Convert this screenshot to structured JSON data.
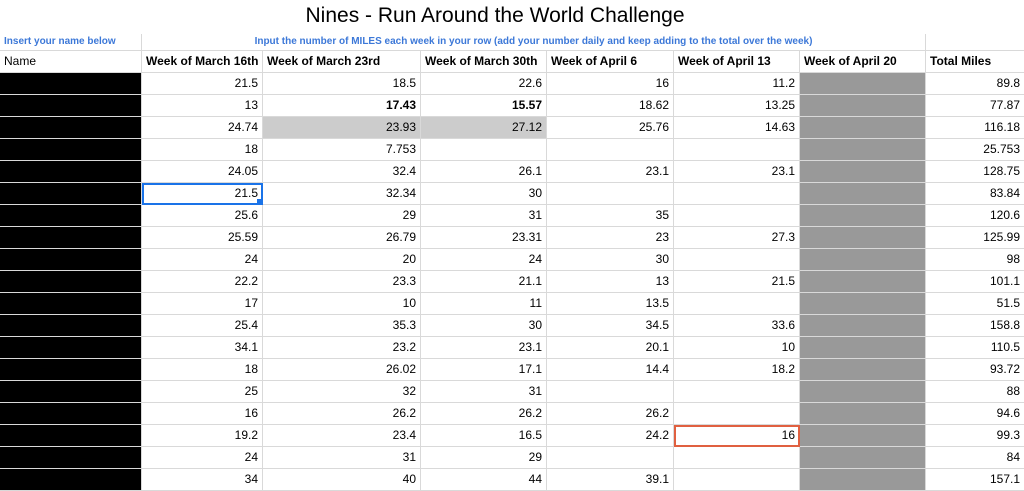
{
  "title": "Nines - Run Around the World Challenge",
  "instructions": {
    "name_hint": "Insert your name below",
    "miles_hint": "Input the number of MILES each week in your row (add your number daily and keep adding to the total over the week)"
  },
  "headers": [
    "Name",
    "Week of March 16th",
    "Week of March 23rd",
    "Week of March 30th",
    "Week of April 6",
    "Week of April 13",
    "Week of April 20",
    "Total Miles"
  ],
  "rows": [
    [
      "",
      "21.5",
      "18.5",
      "22.6",
      "16",
      "11.2",
      "",
      "89.8"
    ],
    [
      "",
      "13",
      "17.43",
      "15.57",
      "18.62",
      "13.25",
      "",
      "77.87"
    ],
    [
      "",
      "24.74",
      "23.93",
      "27.12",
      "25.76",
      "14.63",
      "",
      "116.18"
    ],
    [
      "",
      "18",
      "7.753",
      "",
      "",
      "",
      "",
      "25.753"
    ],
    [
      "",
      "24.05",
      "32.4",
      "26.1",
      "23.1",
      "23.1",
      "",
      "128.75"
    ],
    [
      "",
      "21.5",
      "32.34",
      "30",
      "",
      "",
      "",
      "83.84"
    ],
    [
      "",
      "25.6",
      "29",
      "31",
      "35",
      "",
      "",
      "120.6"
    ],
    [
      "",
      "25.59",
      "26.79",
      "23.31",
      "23",
      "27.3",
      "",
      "125.99"
    ],
    [
      "",
      "24",
      "20",
      "24",
      "30",
      "",
      "",
      "98"
    ],
    [
      "",
      "22.2",
      "23.3",
      "21.1",
      "13",
      "21.5",
      "",
      "101.1"
    ],
    [
      "",
      "17",
      "10",
      "11",
      "13.5",
      "",
      "",
      "51.5"
    ],
    [
      "",
      "25.4",
      "35.3",
      "30",
      "34.5",
      "33.6",
      "",
      "158.8"
    ],
    [
      "",
      "34.1",
      "23.2",
      "23.1",
      "20.1",
      "10",
      "",
      "110.5"
    ],
    [
      "",
      "18",
      "26.02",
      "17.1",
      "14.4",
      "18.2",
      "",
      "93.72"
    ],
    [
      "",
      "25",
      "32",
      "31",
      "",
      "",
      "",
      "88"
    ],
    [
      "",
      "16",
      "26.2",
      "26.2",
      "26.2",
      "",
      "",
      "94.6"
    ],
    [
      "",
      "19.2",
      "23.4",
      "16.5",
      "24.2",
      "16",
      "",
      "99.3"
    ],
    [
      "",
      "24",
      "31",
      "29",
      "",
      "",
      "",
      "84"
    ],
    [
      "",
      "34",
      "40",
      "44",
      "39.1",
      "",
      "",
      "157.1"
    ]
  ],
  "styles": {
    "redact_color": "#000000",
    "week_april20_fill": "#999999",
    "highlight_fill": "#cccccc",
    "hint_color": "#3c78d8",
    "selection_blue": "#1a73e8",
    "selection_red": "#e06040"
  }
}
